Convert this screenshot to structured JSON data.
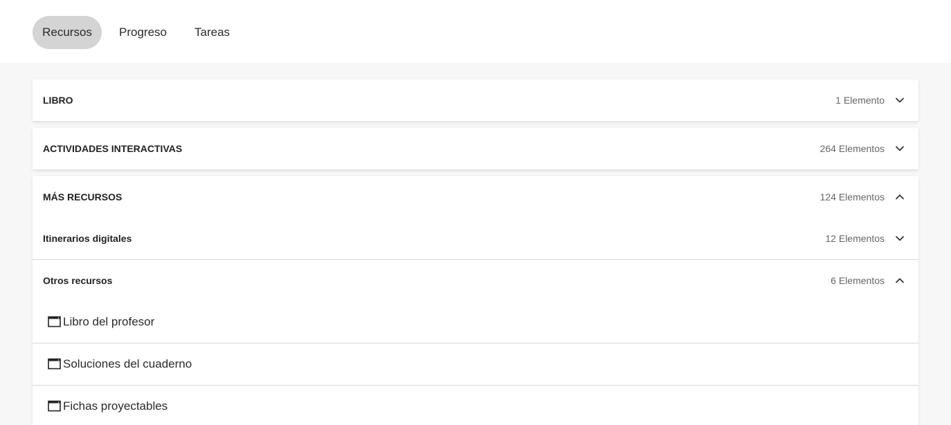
{
  "tabs": [
    {
      "label": "Recursos",
      "active": true
    },
    {
      "label": "Progreso",
      "active": false
    },
    {
      "label": "Tareas",
      "active": false
    }
  ],
  "sections": {
    "libro": {
      "title": "LIBRO",
      "count": "1 Elemento",
      "expanded": false
    },
    "actividades": {
      "title": "ACTIVIDADES INTERACTIVAS",
      "count": "264 Elementos",
      "expanded": false
    },
    "mas_recursos": {
      "title": "MÁS RECURSOS",
      "count": "124 Elementos",
      "expanded": true,
      "subsections": {
        "itinerarios": {
          "title": "Itinerarios digitales",
          "count": "12 Elementos",
          "expanded": false
        },
        "otros": {
          "title": "Otros recursos",
          "count": "6 Elementos",
          "expanded": true,
          "items": [
            {
              "label": "Libro del profesor",
              "icon": "window-icon"
            },
            {
              "label": "Soluciones del cuaderno",
              "icon": "window-icon"
            },
            {
              "label": "Fichas proyectables",
              "icon": "window-icon"
            }
          ]
        }
      }
    }
  },
  "colors": {
    "active_tab_bg": "#d4d4d4",
    "page_bg": "#f7f7f7"
  }
}
